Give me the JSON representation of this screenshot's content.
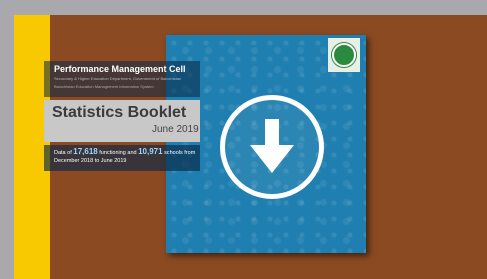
{
  "colors": {
    "frame": "#a9a9ad",
    "accent_bar": "#f8c800",
    "panel": "#8c4a22",
    "booklet": "#1f7fb0"
  },
  "booklet": {
    "logo_icon": "government-seal-icon",
    "header_title": "Performance Management Cell",
    "header_sub": "Secondary & Higher Education Department, Government of Balochistan",
    "header_sub2": "Balochistan Education Management Information System",
    "title": "Statistics Booklet",
    "date": "June 2019",
    "stat_line1_prefix": "Data of",
    "stat_line1_count1": "17,618",
    "stat_line1_middle": "functioning and",
    "stat_line1_count2": "10,971",
    "stat_line1_suffix": "schools from",
    "stat_line2": "December 2018 to June 2019"
  },
  "download_button": {
    "icon": "download-arrow-icon"
  }
}
